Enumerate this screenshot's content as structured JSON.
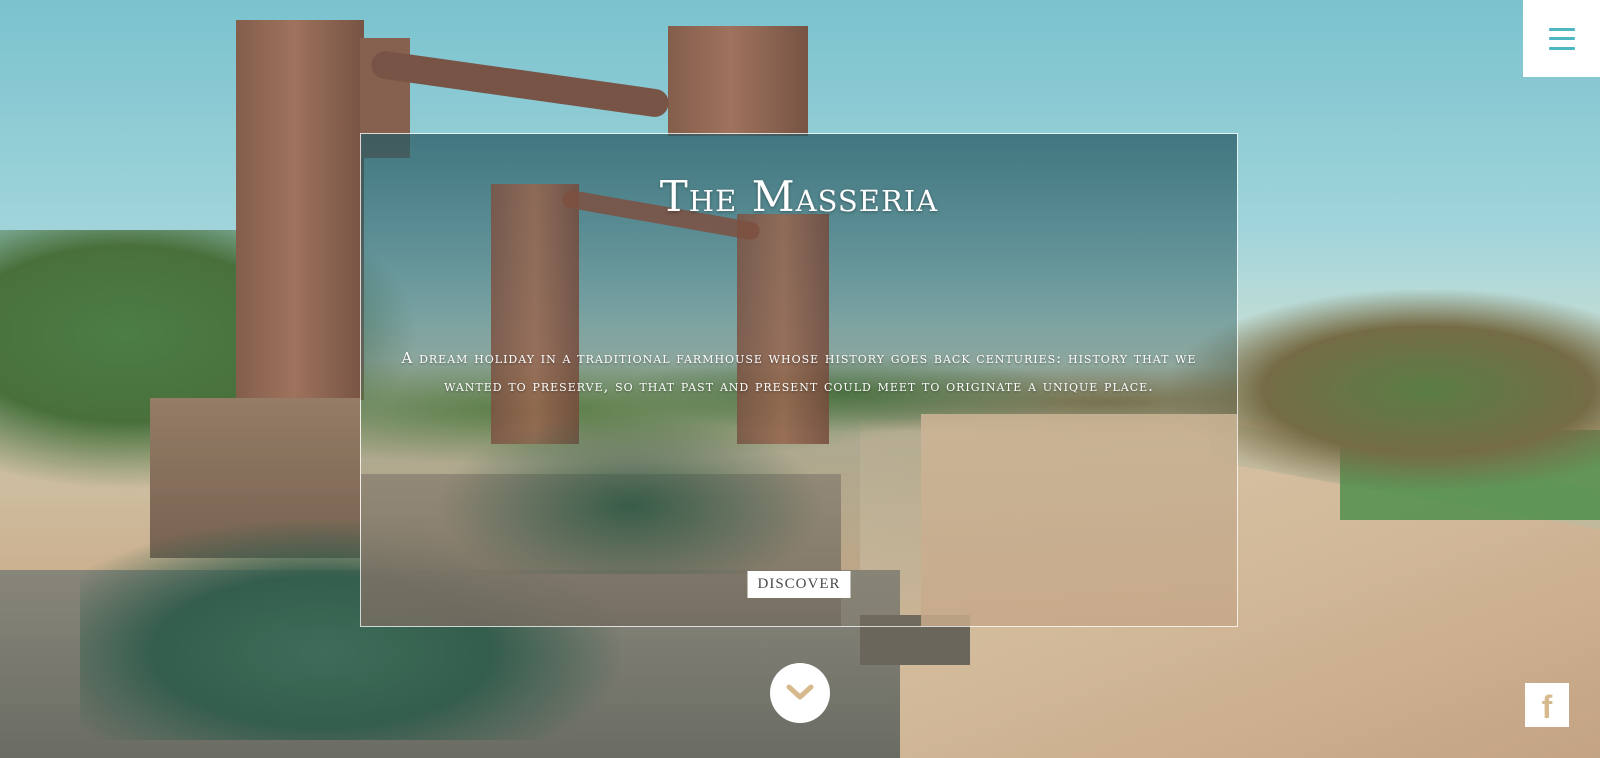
{
  "header": {
    "menu_icon": "hamburger-icon",
    "accent_color": "#4fb7c3"
  },
  "hero": {
    "title": "The Masseria",
    "description": "A dream holiday in a traditional farmhouse whose history goes back centuries: history that we wanted to preserve, so that past and present could meet to originate a unique place.",
    "discover_label": "DISCOVER"
  },
  "scroll": {
    "icon": "chevron-down-icon"
  },
  "social": {
    "facebook_icon": "facebook-icon",
    "facebook_glyph": "f",
    "facebook_color": "#d6b98d"
  }
}
